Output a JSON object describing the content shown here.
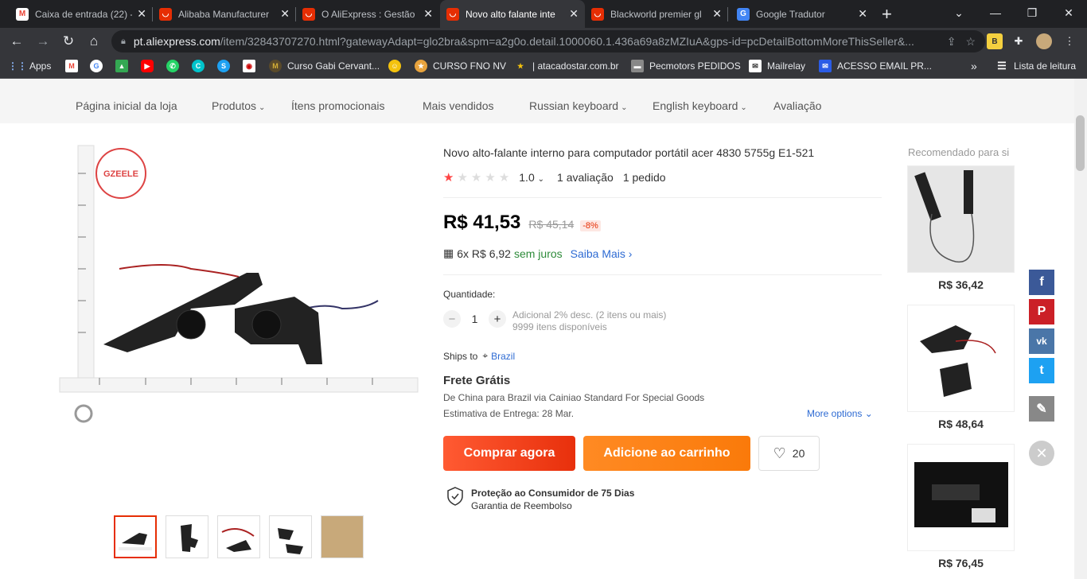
{
  "browser": {
    "tabs": [
      {
        "title": "Caixa de entrada (22) -",
        "favicon": "gmail-icon",
        "color": "#ea4335"
      },
      {
        "title": "Alibaba Manufacturer",
        "favicon": "aliexpress-icon",
        "color": "#e62e04"
      },
      {
        "title": "O AliExpress : Gestão",
        "favicon": "aliexpress-icon",
        "color": "#e62e04"
      },
      {
        "title": "Novo alto falante inte",
        "favicon": "aliexpress-icon",
        "color": "#e62e04"
      },
      {
        "title": "Blackworld premier gl",
        "favicon": "aliexpress-icon",
        "color": "#e62e04"
      },
      {
        "title": "Google Tradutor",
        "favicon": "translate-icon",
        "color": "#4285f4"
      }
    ],
    "url_host": "pt.aliexpress.com",
    "url_path": "/item/32843707270.html?gatewayAdapt=glo2bra&spm=a2g0o.detail.1000060.1.436a69a8zMZIuA&gps-id=pcDetailBottomMoreThisSeller&...",
    "bookmarks": [
      "Apps",
      "Curso Gabi Cervant...",
      "CURSO FNO NV",
      "| atacadostar.com.br",
      "Pecmotors PEDIDOS",
      "Mailrelay",
      "ACESSO EMAIL PR...",
      "Lista de leitura"
    ]
  },
  "storenav": {
    "home": "Página inicial da loja",
    "products": "Produtos",
    "promo": "Ítens promocionais",
    "best": "Mais vendidos",
    "ru_kb": "Russian keyboard",
    "en_kb": "English keyboard",
    "review": "Avaliação"
  },
  "product": {
    "title": "Novo alto-falante interno para computador portátil acer 4830 5755g E1-521",
    "rating": "1.0",
    "rating_value": 1,
    "reviews": "1 avaliação",
    "orders": "1 pedido",
    "price": "R$ 41,53",
    "old_price": "R$ 45,14",
    "discount": "-8%",
    "installments": "6x R$ 6,92",
    "no_interest": "sem juros",
    "learn_more": "Saiba Mais",
    "qty_label": "Quantidade:",
    "qty": "1",
    "qty_info1": "Adicional 2% desc. (2 itens ou mais)",
    "qty_info2": "9999 itens disponíveis",
    "ships_to": "Ships to",
    "country": "Brazil",
    "shipping_title": "Frete Grátis",
    "shipping_via": "De China para Brazil via Cainiao Standard For Special Goods",
    "eta": "Estimativa de Entrega: 28 Mar.",
    "more_options": "More options",
    "buy_now": "Comprar agora",
    "add_cart": "Adicione ao carrinho",
    "wishlist": "20",
    "protect_title": "Proteção ao Consumidor de 75 Dias",
    "protect_sub": "Garantia de Reembolso",
    "brand_stamp": "GZEELE"
  },
  "recommended": {
    "title": "Recomendado para si",
    "items": [
      {
        "price": "R$ 36,42"
      },
      {
        "price": "R$ 48,64"
      },
      {
        "price": "R$ 76,45"
      }
    ]
  },
  "colors": {
    "accent": "#e62e04",
    "buy": "#ff4d1c",
    "cart": "#ff8a1c"
  }
}
